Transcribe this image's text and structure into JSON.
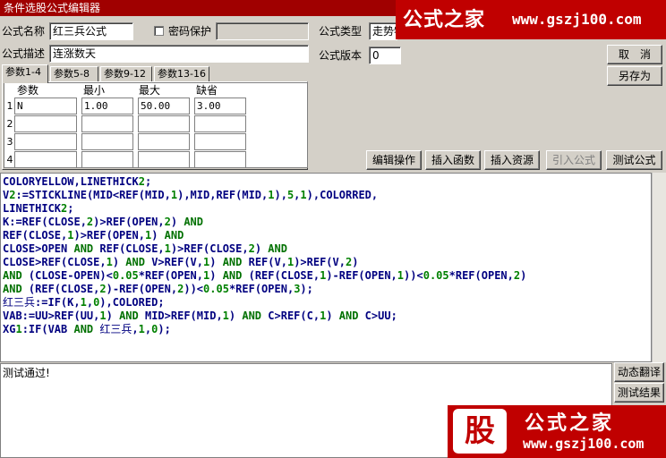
{
  "window": {
    "title": "条件选股公式编辑器"
  },
  "watermark_top": {
    "cn": "公式之家",
    "url": "www.gszj100.com"
  },
  "watermark_bottom": {
    "mark": "股",
    "cn": "公式之家",
    "url": "www.gszj100.com"
  },
  "form": {
    "name_label": "公式名称",
    "name_value": "红三兵公式",
    "password_label": "密码保护",
    "password_value": "",
    "type_label": "公式类型",
    "type_value": "走势特征",
    "desc_label": "公式描述",
    "desc_value": "连涨数天",
    "version_label": "公式版本",
    "version_value": "0"
  },
  "buttons": {
    "cancel": "取　消",
    "save_as": "另存为",
    "edit_ops": "编辑操作",
    "insert_func": "插入函数",
    "insert_res": "插入资源",
    "import_formula": "引入公式",
    "test_formula": "测试公式",
    "dyn_translate": "动态翻译",
    "test_result": "测试结果"
  },
  "tabs": [
    "参数1-4",
    "参数5-8",
    "参数9-12",
    "参数13-16"
  ],
  "params": {
    "headers": [
      "参数",
      "最小",
      "最大",
      "缺省"
    ],
    "rows": [
      {
        "num": "1",
        "name": "N",
        "min": "1.00",
        "max": "50.00",
        "def": "3.00"
      },
      {
        "num": "2",
        "name": "",
        "min": "",
        "max": "",
        "def": ""
      },
      {
        "num": "3",
        "name": "",
        "min": "",
        "max": "",
        "def": ""
      },
      {
        "num": "4",
        "name": "",
        "min": "",
        "max": "",
        "def": ""
      }
    ]
  },
  "code": [
    "COLORYELLOW,LINETHICK2;",
    "V2:=STICKLINE(MID<REF(MID,1),MID,REF(MID,1),5,1),COLORRED,",
    "LINETHICK2;",
    "K:=REF(CLOSE,2)>REF(OPEN,2) AND",
    "REF(CLOSE,1)>REF(OPEN,1) AND",
    "CLOSE>OPEN AND REF(CLOSE,1)>REF(CLOSE,2) AND",
    "CLOSE>REF(CLOSE,1) AND V>REF(V,1) AND REF(V,1)>REF(V,2)",
    "AND (CLOSE-OPEN)<0.05*REF(OPEN,1) AND (REF(CLOSE,1)-REF(OPEN,1))<0.05*REF(OPEN,2)",
    "AND (REF(CLOSE,2)-REF(OPEN,2))<0.05*REF(OPEN,3);",
    "红三兵:=IF(K,1,0),COLORED;",
    "VAB:=UU>REF(UU,1) AND MID>REF(MID,1) AND C>REF(C,1) AND C>UU;",
    "XG1:IF(VAB AND 红三兵,1,0);"
  ],
  "status": {
    "message": "测试通过!"
  },
  "colors": {
    "title_bar": "#a00000",
    "keyword": "#000080",
    "number": "#008000"
  }
}
